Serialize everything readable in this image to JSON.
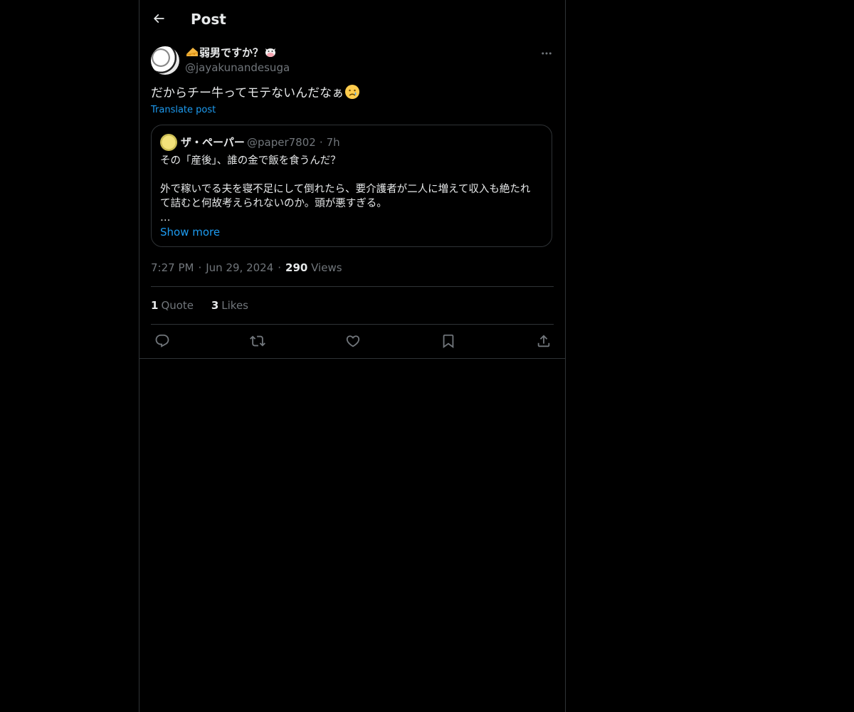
{
  "header": {
    "title": "Post"
  },
  "post": {
    "author": {
      "name_prefix_emoji": "cheese-emoji",
      "name": "弱男ですか？",
      "name_suffix_emoji": "cow-face-emoji",
      "handle": "@jayakunandesuga"
    },
    "text": "だからチー牛ってモテないんだなぁ",
    "text_emoji": "crying-face-emoji",
    "translate_label": "Translate post",
    "timestamp": {
      "time": "7:27 PM",
      "date": "Jun 29, 2024",
      "views_count": "290",
      "views_label": "Views"
    },
    "stats": {
      "quotes_count": "1",
      "quotes_label": "Quote",
      "likes_count": "3",
      "likes_label": "Likes"
    }
  },
  "quoted_post": {
    "name": "ザ・ペーパー",
    "handle": "@paper7802",
    "age": "7h",
    "line1": "その「産後」、誰の金で飯を食うんだ？",
    "line2": "外で稼いでる夫を寝不足にして倒れたら、要介護者が二人に増えて収入も絶たれ",
    "line3": "て詰むと何故考えられないのか。頭が悪すぎる。",
    "ellipsis": "…",
    "show_more": "Show more"
  },
  "actions": [
    "reply-icon",
    "repost-icon",
    "like-icon",
    "bookmark-icon",
    "share-icon"
  ],
  "colors": {
    "background": "#000000",
    "text": "#e7e9ea",
    "muted": "#71767b",
    "accent": "#1d9bf0",
    "border": "#2f3336"
  }
}
